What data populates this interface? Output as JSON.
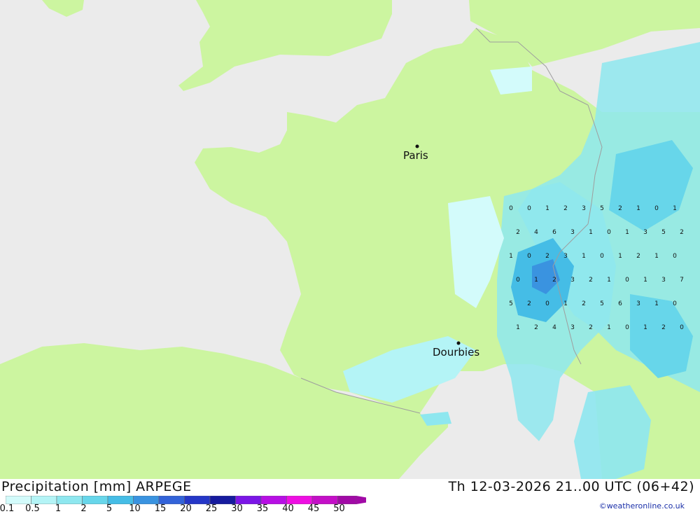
{
  "legend": {
    "title": "Precipitation [mm] ARPEGE",
    "ticks": [
      "0.1",
      "0.5",
      "1",
      "2",
      "5",
      "10",
      "15",
      "20",
      "25",
      "30",
      "35",
      "40",
      "45",
      "50"
    ],
    "colors": [
      "#d3fbfb",
      "#b4f4f6",
      "#8ee7ef",
      "#67d6ea",
      "#45bde6",
      "#3a93e0",
      "#3363d9",
      "#2537c7",
      "#161b9e",
      "#7b16e6",
      "#b70fe4",
      "#ee0ee2",
      "#c40fc7",
      "#a10aa6"
    ]
  },
  "valid_time": "Th 12-03-2026 21..00 UTC (06+42)",
  "credit": "©weatheronline.co.uk",
  "cities": [
    {
      "name": "Paris"
    },
    {
      "name": "Dourbies"
    }
  ],
  "map_colors": {
    "sea": "#ebebeb",
    "land": "#ccf5a0",
    "border": "#9e9e9e",
    "city_dot": "#111111"
  },
  "grid_values": [
    "0",
    "0",
    "1",
    "2",
    "3",
    "5",
    "2",
    "1",
    "0",
    "1",
    "2",
    "4",
    "6",
    "3",
    "1",
    "0",
    "1",
    "3",
    "5",
    "2",
    "1",
    "0",
    "2",
    "3",
    "1",
    "0",
    "1",
    "2",
    "1",
    "0",
    "0",
    "1",
    "2",
    "3",
    "2",
    "1",
    "0",
    "1",
    "3",
    "7",
    "5",
    "2",
    "0",
    "1",
    "2",
    "5",
    "6",
    "3",
    "1",
    "0",
    "1",
    "2",
    "4",
    "3",
    "2",
    "1",
    "0",
    "1",
    "2",
    "0"
  ]
}
